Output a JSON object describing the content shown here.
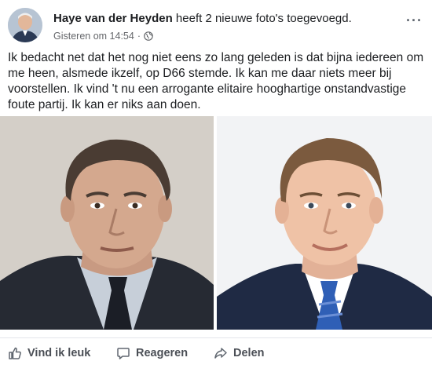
{
  "post": {
    "author": "Haye van der Heyden",
    "action": "heeft 2 nieuwe foto's toegevoegd.",
    "timestamp": "Gisteren om 14:54",
    "separator": "·",
    "audience_icon": "globe-icon",
    "more_icon": "ellipsis-icon",
    "more_label": "···",
    "text": "Ik bedacht net dat het nog niet eens zo lang geleden is dat bijna iedereen om me heen, alsmede ikzelf, op D66 stemde. Ik kan me daar niets meer bij voorstellen. Ik vind 't nu een arrogante elitaire hooghartige onstandvastige foute partij. Ik kan er niks aan doen."
  },
  "photos": [
    {
      "icon": "portrait-photo",
      "subject": "older man in dark suit"
    },
    {
      "icon": "portrait-photo",
      "subject": "man in navy suit with blue tie"
    }
  ],
  "actions": {
    "like": {
      "label": "Vind ik leuk",
      "icon": "thumbs-up-icon"
    },
    "comment": {
      "label": "Reageren",
      "icon": "comment-icon"
    },
    "share": {
      "label": "Delen",
      "icon": "share-icon"
    }
  },
  "colors": {
    "text": "#1c1e21",
    "meta": "#65676b",
    "action": "#4b4f56",
    "divider": "#e4e6eb"
  }
}
